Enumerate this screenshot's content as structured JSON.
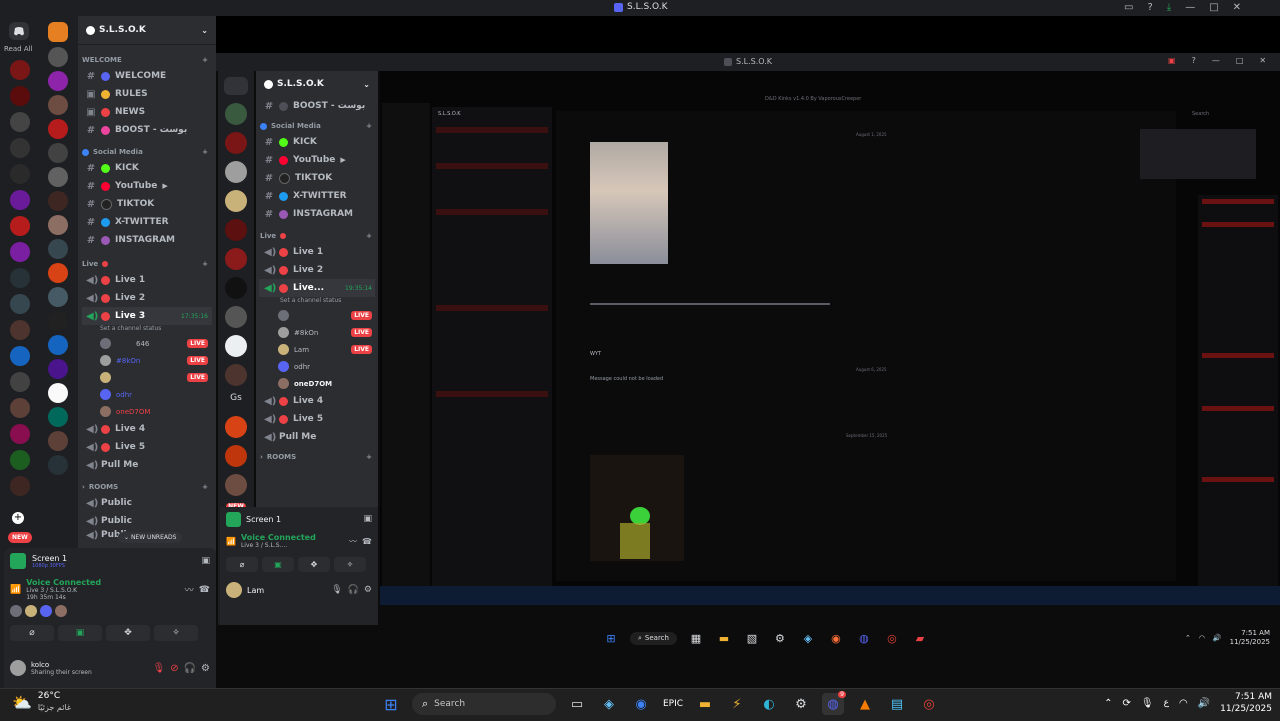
{
  "outer": {
    "read_all": "Read All",
    "server_name": "S.L.S.O.K",
    "new_badge": "NEW",
    "categories": {
      "welcome": "WELCOME",
      "social": "Social Media",
      "live": "Live",
      "rooms": "ROOMS"
    },
    "channels": {
      "welcome": "WELCOME",
      "rules": "RULES",
      "news": "NEWS",
      "boost": "BOOST - بوست",
      "kick": "KICK",
      "youtube": "YouTube",
      "tiktok": "TIKTOK",
      "xtwitter": "X-TWITTER",
      "instagram": "INSTAGRAM",
      "live1": "Live 1",
      "live2": "Live 2",
      "live3": "Live 3",
      "live4": "Live 4",
      "live5": "Live 5",
      "pullme": "Pull Me",
      "public1": "Public",
      "public2": "Public",
      "public3": "Public"
    },
    "live3_time": "17:35:16",
    "live3_status": "Set a channel status",
    "live_users": [
      {
        "name": "646",
        "live": "LIVE"
      },
      {
        "name": "#8kOn",
        "live": "LIVE"
      },
      {
        "name": "",
        "live": "LIVE"
      },
      {
        "name": "odhr",
        "live": ""
      },
      {
        "name": "oneD7OM",
        "live": ""
      }
    ],
    "new_unreads": "NEW UNREADS",
    "screen_title": "Screen 1",
    "screen_sub": "1080p 30FPS",
    "voice_connected": "Voice Connected",
    "voice_channel": "Live 3 / S.L.S.O.K",
    "voice_time": "19h 35m 14s",
    "user_name": "kolco",
    "user_status": "Sharing their screen"
  },
  "shared": {
    "title": "S.L.S.O.K",
    "server_name": "S.L.S.O.K",
    "categories": {
      "social": "Social Media",
      "live": "Live",
      "rooms": "ROOMS"
    },
    "channels": {
      "boost": "BOOST - بوست",
      "kick": "KICK",
      "youtube": "YouTube",
      "tiktok": "TIKTOK",
      "xtwitter": "X-TWITTER",
      "instagram": "INSTAGRAM",
      "live1": "Live 1",
      "live2": "Live 2",
      "live3": "Live...",
      "live4": "Live 4",
      "live5": "Live 5",
      "pullme": "Pull Me"
    },
    "live3_time": "19:35:14",
    "live3_status": "Set a channel status",
    "live_users": [
      {
        "name": "",
        "live": "LIVE"
      },
      {
        "name": "#8kOn",
        "live": "LIVE"
      },
      {
        "name": "Lam",
        "live": "LIVE"
      },
      {
        "name": "odhr",
        "live": ""
      },
      {
        "name": "oneD7OM",
        "live": ""
      }
    ],
    "gs_label": "Gs",
    "new_badge": "NEW",
    "screen_title": "Screen 1",
    "voice_connected": "Voice Connected",
    "voice_channel": "Live 3 / S.L.S....",
    "user_name": "Lam",
    "nested_title": "S.L.S.O.K",
    "nested_caption": "D&D Kinks v1.4.0 By VaporousCreeper",
    "chat_text_1": "Message could not be loaded",
    "chat_date_1": "August 1, 2025",
    "chat_date_2": "August 6, 2025",
    "chat_date_3": "September 15, 2025",
    "chat_wyt": "WYT",
    "inner_search": "Search",
    "inner_time": "7:51 AM",
    "inner_date": "11/25/2025"
  },
  "taskbar": {
    "weather_temp": "26°C",
    "weather_desc": "غائم جزئيًا",
    "search_placeholder": "Search",
    "time": "7:51 AM",
    "date": "11/25/2025",
    "lang": "ع",
    "discord_badge": "9"
  },
  "colors": {
    "outer_bg": "#1e1f22",
    "sidebar_bg": "#2b2d31",
    "accent_red": "#ed4245",
    "green": "#23a55a",
    "taskbar": "#202020"
  }
}
